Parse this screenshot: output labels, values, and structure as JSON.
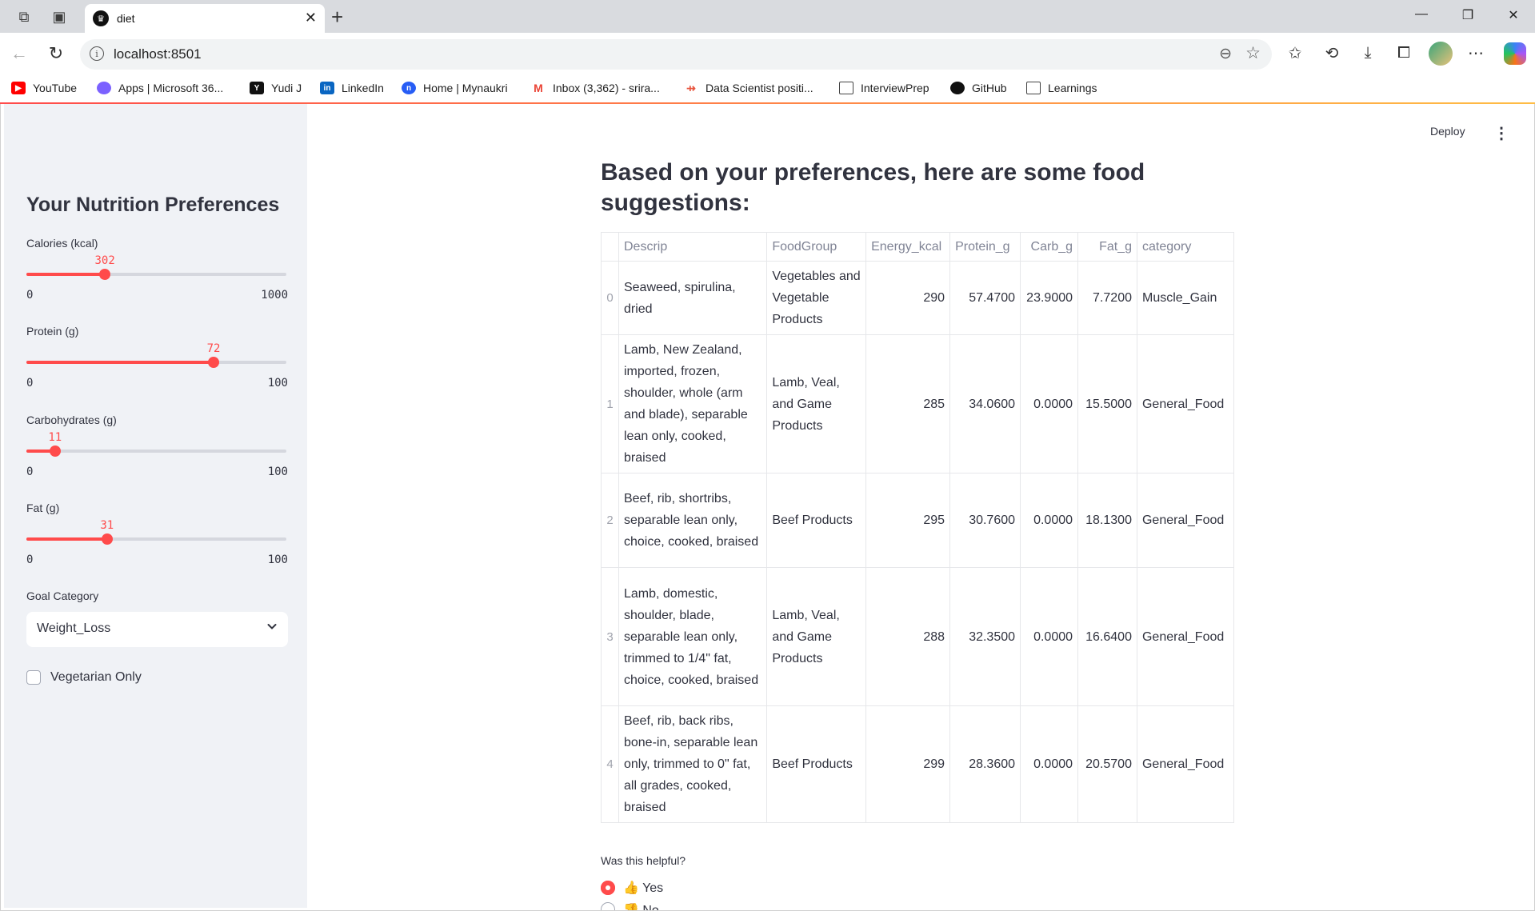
{
  "browser": {
    "tab_title": "diet",
    "url": "localhost:8501",
    "bookmarks": [
      {
        "label": "YouTube",
        "icon": "youtube-icon",
        "color": "#ff0000"
      },
      {
        "label": "Apps | Microsoft 36...",
        "icon": "microsoft365-icon",
        "color": "#7b61ff"
      },
      {
        "label": "Yudi J",
        "icon": "yudi-icon",
        "color": "#111111"
      },
      {
        "label": "LinkedIn",
        "icon": "linkedin-icon",
        "color": "#0a66c2"
      },
      {
        "label": "Home | Mynaukri",
        "icon": "naukri-icon",
        "color": "#275df5"
      },
      {
        "label": "Inbox (3,362) - srira...",
        "icon": "gmail-icon",
        "color": "#ea4335"
      },
      {
        "label": "Data Scientist positi...",
        "icon": "job-icon",
        "color": "#e8553e"
      },
      {
        "label": "InterviewPrep",
        "icon": "folder-icon",
        "color": "#444444"
      },
      {
        "label": "GitHub",
        "icon": "github-icon",
        "color": "#111111"
      },
      {
        "label": "Learnings",
        "icon": "folder-icon",
        "color": "#444444"
      }
    ]
  },
  "sidebar": {
    "title": "Your Nutrition Preferences",
    "sliders": [
      {
        "label": "Calories (kcal)",
        "value": "302",
        "min": "0",
        "max": "1000",
        "fraction": 0.302
      },
      {
        "label": "Protein (g)",
        "value": "72",
        "min": "0",
        "max": "100",
        "fraction": 0.72
      },
      {
        "label": "Carbohydrates (g)",
        "value": "11",
        "min": "0",
        "max": "100",
        "fraction": 0.11
      },
      {
        "label": "Fat (g)",
        "value": "31",
        "min": "0",
        "max": "100",
        "fraction": 0.31
      }
    ],
    "goal_label": "Goal Category",
    "goal_value": "Weight_Loss",
    "vegetarian_label": "Vegetarian Only"
  },
  "header": {
    "deploy_label": "Deploy"
  },
  "main": {
    "heading": "Based on your preferences, here are some food suggestions:",
    "table": {
      "columns": [
        "",
        "Descrip",
        "FoodGroup",
        "Energy_kcal",
        "Protein_g",
        "Carb_g",
        "Fat_g",
        "category"
      ],
      "rows": [
        [
          "0",
          "Seaweed, spirulina, dried",
          "Vegetables and Vegetable Products",
          "290",
          "57.4700",
          "23.9000",
          "7.7200",
          "Muscle_Gain"
        ],
        [
          "1",
          "Lamb, New Zealand, imported, frozen, shoulder, whole (arm and blade), separable lean only, cooked, braised",
          "Lamb, Veal, and Game Products",
          "285",
          "34.0600",
          "0.0000",
          "15.5000",
          "General_Food"
        ],
        [
          "2",
          "Beef, rib, shortribs, separable lean only, choice, cooked, braised",
          "Beef Products",
          "295",
          "30.7600",
          "0.0000",
          "18.1300",
          "General_Food"
        ],
        [
          "3",
          "Lamb, domestic, shoulder, blade, separable lean only, trimmed to 1/4\" fat, choice, cooked, braised",
          "Lamb, Veal, and Game Products",
          "288",
          "32.3500",
          "0.0000",
          "16.6400",
          "General_Food"
        ],
        [
          "4",
          "Beef, rib, back ribs, bone-in, separable lean only, trimmed to 0\" fat, all grades, cooked, braised",
          "Beef Products",
          "299",
          "28.3600",
          "0.0000",
          "20.5700",
          "General_Food"
        ]
      ]
    },
    "feedback_label": "Was this helpful?",
    "options": [
      {
        "label": "👍 Yes",
        "selected": true
      },
      {
        "label": "👎 No",
        "selected": false
      }
    ]
  }
}
